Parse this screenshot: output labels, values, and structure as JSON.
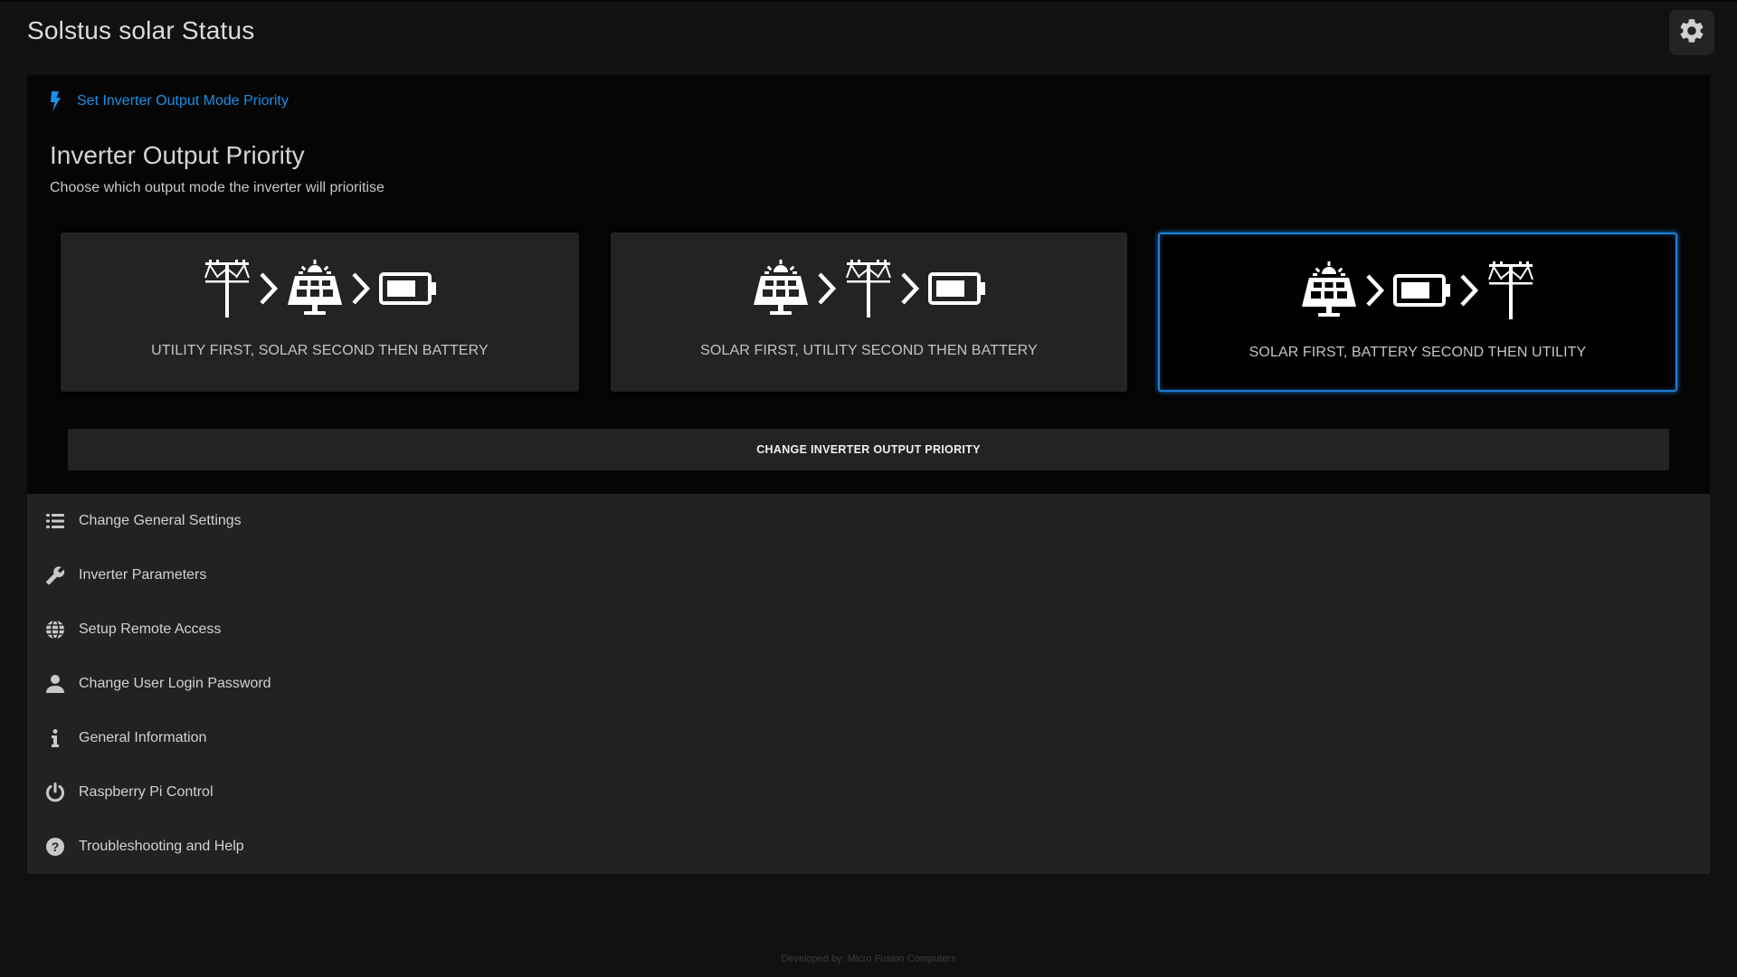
{
  "header": {
    "title": "Solstus solar Status",
    "settings_icon": "gear-icon"
  },
  "priority_panel": {
    "link_icon": "lightning-bolt-icon",
    "link_label": "Set Inverter Output Mode Priority",
    "heading": "Inverter Output Priority",
    "subtitle": "Choose which output mode the inverter will prioritise",
    "selected_index": 2,
    "accent_color": "#1c7fd6",
    "options": [
      {
        "label": "UTILITY FIRST, SOLAR SECOND THEN BATTERY",
        "icons": [
          "utility-pole-icon",
          "chevron-right-icon",
          "solar-panel-icon",
          "chevron-right-icon",
          "battery-icon"
        ],
        "selected": false
      },
      {
        "label": "SOLAR FIRST, UTILITY SECOND THEN BATTERY",
        "icons": [
          "solar-panel-icon",
          "chevron-right-icon",
          "utility-pole-icon",
          "chevron-right-icon",
          "battery-icon"
        ],
        "selected": false
      },
      {
        "label": "SOLAR FIRST, BATTERY SECOND THEN UTILITY",
        "icons": [
          "solar-panel-icon",
          "chevron-right-icon",
          "battery-icon",
          "chevron-right-icon",
          "utility-pole-icon"
        ],
        "selected": true
      }
    ],
    "action_button": "CHANGE INVERTER OUTPUT PRIORITY"
  },
  "menu": {
    "items": [
      {
        "label": "Change General Settings",
        "icon": "list-icon"
      },
      {
        "label": "Inverter Parameters",
        "icon": "wrench-icon"
      },
      {
        "label": "Setup Remote Access",
        "icon": "globe-icon"
      },
      {
        "label": "Change User Login Password",
        "icon": "user-icon"
      },
      {
        "label": "General Information",
        "icon": "info-icon"
      },
      {
        "label": "Raspberry Pi Control",
        "icon": "power-icon"
      },
      {
        "label": "Troubleshooting and Help",
        "icon": "question-circle-icon"
      }
    ]
  },
  "footer": {
    "text": "Developed by: Micro Fusion Computers"
  }
}
